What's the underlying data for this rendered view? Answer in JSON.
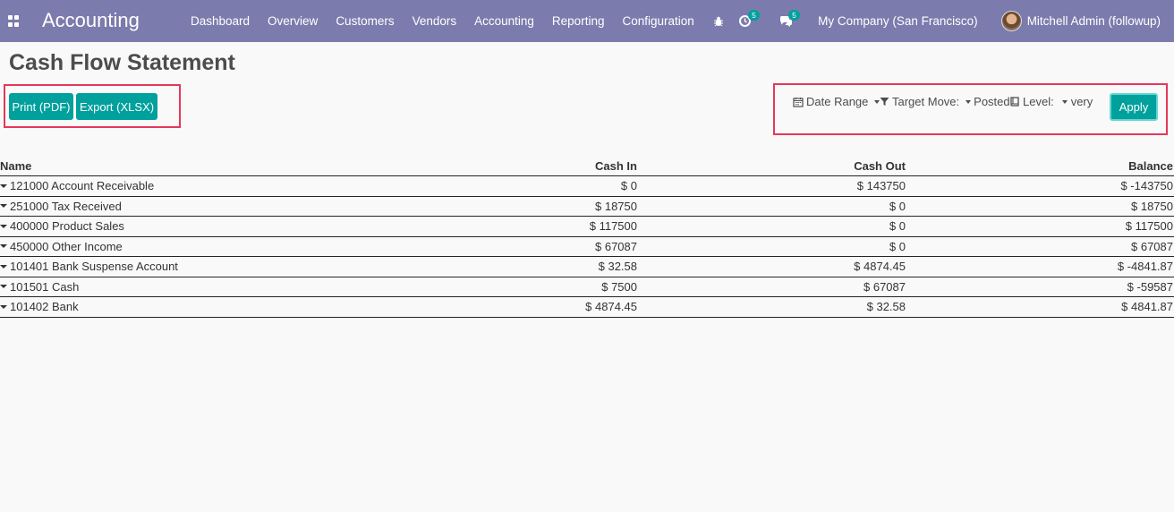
{
  "navbar": {
    "app_name": "Accounting",
    "menu": [
      "Dashboard",
      "Overview",
      "Customers",
      "Vendors",
      "Accounting",
      "Reporting",
      "Configuration"
    ],
    "activity_count": "5",
    "messages_count": "5",
    "company": "My Company (San Francisco)",
    "user": "Mitchell Admin (followup)"
  },
  "page": {
    "title": "Cash Flow Statement"
  },
  "actions": {
    "print_label": "Print (PDF)",
    "export_label": "Export (XLSX)"
  },
  "filters": {
    "date_range_label": "Date Range",
    "target_move_label": "Target Move:",
    "target_move_value": "Posted",
    "level_label": "Level:",
    "level_value": "very",
    "apply_label": "Apply"
  },
  "table": {
    "headers": {
      "name": "Name",
      "cash_in": "Cash In",
      "cash_out": "Cash Out",
      "balance": "Balance"
    },
    "rows": [
      {
        "name": "121000 Account Receivable",
        "cash_in": "$ 0",
        "cash_out": "$ 143750",
        "balance": "$ -143750"
      },
      {
        "name": "251000 Tax Received",
        "cash_in": "$ 18750",
        "cash_out": "$ 0",
        "balance": "$ 18750"
      },
      {
        "name": "400000 Product Sales",
        "cash_in": "$ 117500",
        "cash_out": "$ 0",
        "balance": "$ 117500"
      },
      {
        "name": "450000 Other Income",
        "cash_in": "$ 67087",
        "cash_out": "$ 0",
        "balance": "$ 67087"
      },
      {
        "name": "101401 Bank Suspense Account",
        "cash_in": "$ 32.58",
        "cash_out": "$ 4874.45",
        "balance": "$ -4841.87"
      },
      {
        "name": "101501 Cash",
        "cash_in": "$ 7500",
        "cash_out": "$ 67087",
        "balance": "$ -59587"
      },
      {
        "name": "101402 Bank",
        "cash_in": "$ 4874.45",
        "cash_out": "$ 32.58",
        "balance": "$ 4841.87"
      }
    ]
  },
  "colors": {
    "navbar": "#7c7bad",
    "primary": "#00a09d",
    "highlight": "#e4385a"
  }
}
